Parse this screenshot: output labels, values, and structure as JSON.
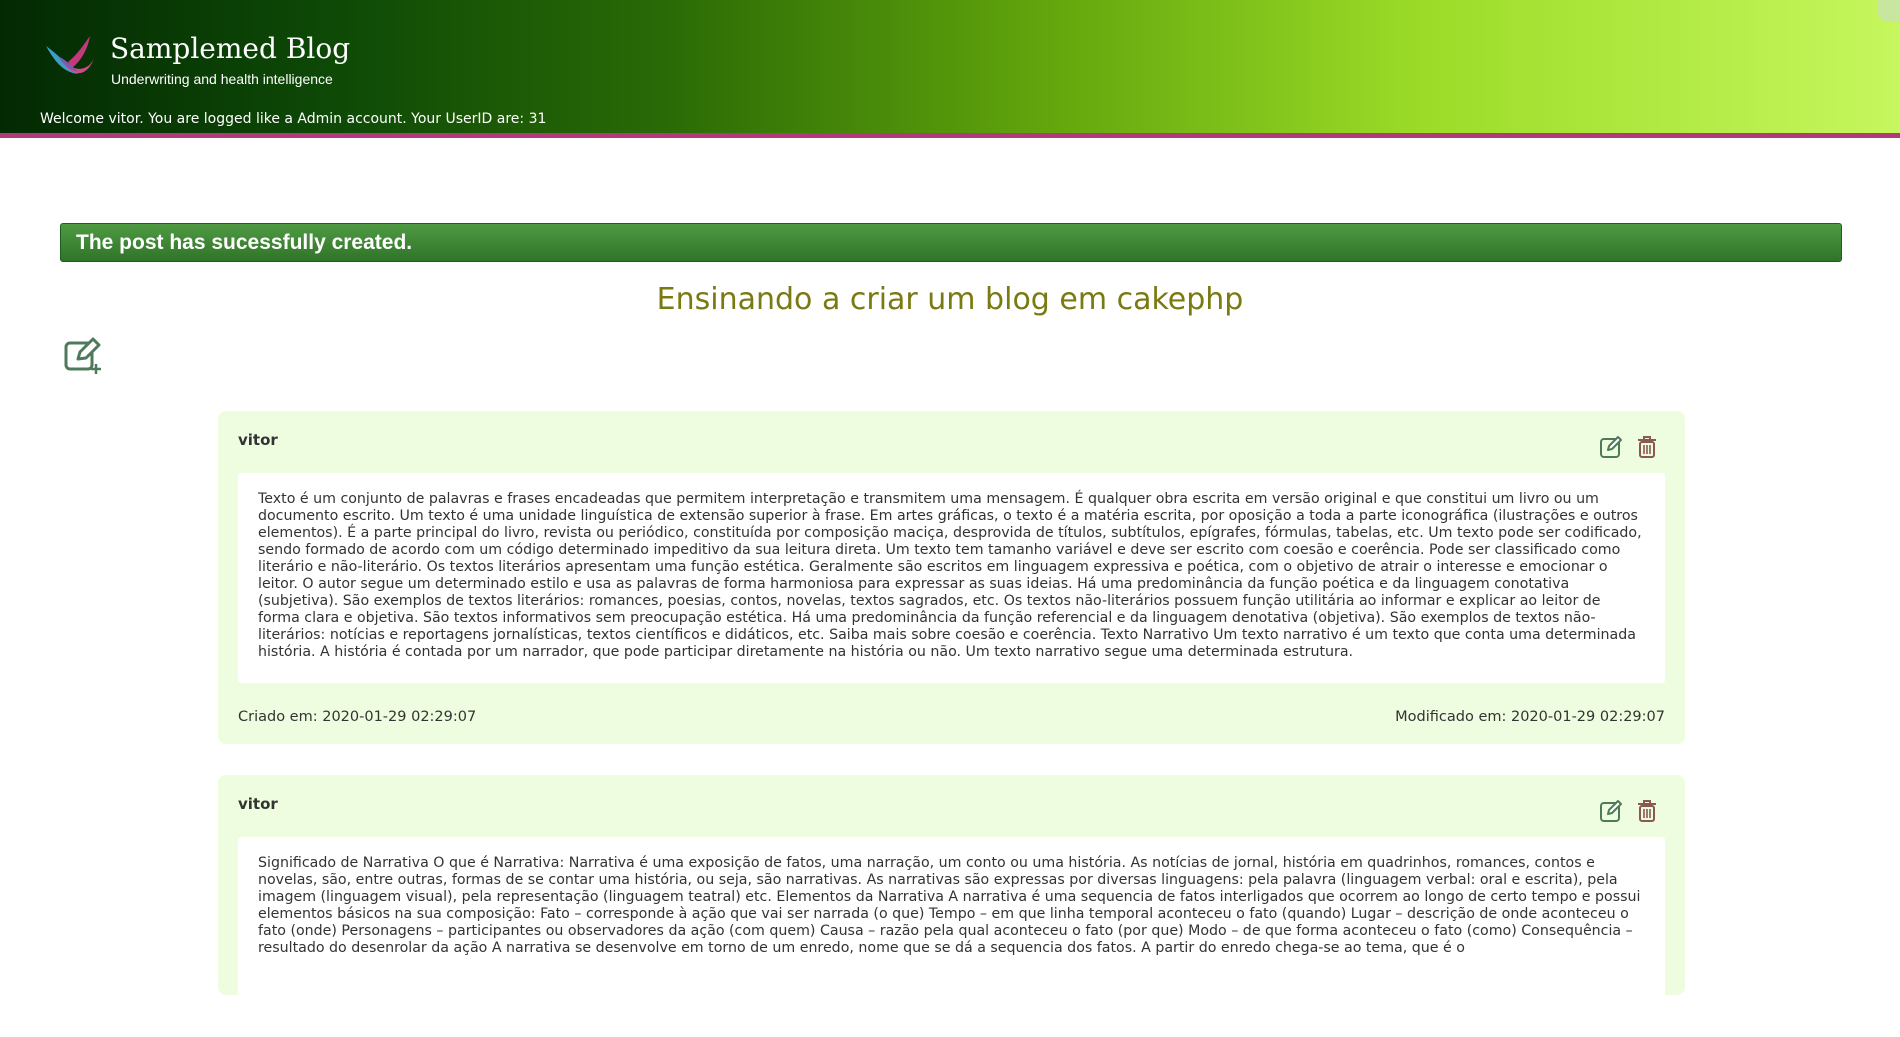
{
  "header": {
    "site_title": "Samplemed Blog",
    "site_subtitle": "Underwriting and health intelligence",
    "welcome": "Welcome vitor. You are logged like a Admin account. Your UserID are: 31",
    "accent_color": "#b03a7a"
  },
  "flash": {
    "message": "The post has sucessfully created."
  },
  "page": {
    "title": "Ensinando a criar um blog em cakephp",
    "new_post_icon": "add-post-icon"
  },
  "posts": [
    {
      "author": "vitor",
      "body": "Texto é um conjunto de palavras e frases encadeadas que permitem interpretação e transmitem uma mensagem. É qualquer obra escrita em versão original e que constitui um livro ou um documento escrito. Um texto é uma unidade linguística de extensão superior à frase. Em artes gráficas, o texto é a matéria escrita, por oposição a toda a parte iconográfica (ilustrações e outros elementos). É a parte principal do livro, revista ou periódico, constituída por composição maciça, desprovida de títulos, subtítulos, epígrafes, fórmulas, tabelas, etc. Um texto pode ser codificado, sendo formado de acordo com um código determinado impeditivo da sua leitura direta. Um texto tem tamanho variável e deve ser escrito com coesão e coerência. Pode ser classificado como literário e não-literário. Os textos literários apresentam uma função estética. Geralmente são escritos em linguagem expressiva e poética, com o objetivo de atrair o interesse e emocionar o leitor. O autor segue um determinado estilo e usa as palavras de forma harmoniosa para expressar as suas ideias. Há uma predominância da função poética e da linguagem conotativa (subjetiva). São exemplos de textos literários: romances, poesias, contos, novelas, textos sagrados, etc. Os textos não-literários possuem função utilitária ao informar e explicar ao leitor de forma clara e objetiva. São textos informativos sem preocupação estética. Há uma predominância da função referencial e da linguagem denotativa (objetiva). São exemplos de textos não-literários: notícias e reportagens jornalísticas, textos científicos e didáticos, etc. Saiba mais sobre coesão e coerência. Texto Narrativo Um texto narrativo é um texto que conta uma determinada história. A história é contada por um narrador, que pode participar diretamente na história ou não. Um texto narrativo segue uma determinada estrutura.",
      "created": "Criado em: 2020-01-29 02:29:07",
      "modified": "Modificado em: 2020-01-29 02:29:07"
    },
    {
      "author": "vitor",
      "body": "Significado de Narrativa O que é Narrativa: Narrativa é uma exposição de fatos, uma narração, um conto ou uma história. As notícias de jornal, história em quadrinhos, romances, contos e novelas, são, entre outras, formas de se contar uma história, ou seja, são narrativas. As narrativas são expressas por diversas linguagens: pela palavra (linguagem verbal: oral e escrita), pela imagem (linguagem visual), pela representação (linguagem teatral) etc. Elementos da Narrativa A narrativa é uma sequencia de fatos interligados que ocorrem ao longo de certo tempo e possui elementos básicos na sua composição: Fato – corresponde à ação que vai ser narrada (o que) Tempo – em que linha temporal aconteceu o fato (quando) Lugar – descrição de onde aconteceu o fato (onde) Personagens – participantes ou observadores da ação (com quem) Causa – razão pela qual aconteceu o fato (por que) Modo – de que forma aconteceu o fato (como) Consequência – resultado do desenrolar da ação A narrativa se desenvolve em torno de um enredo, nome que se dá a sequencia dos fatos. A partir do enredo chega-se ao tema, que é o"
    }
  ]
}
